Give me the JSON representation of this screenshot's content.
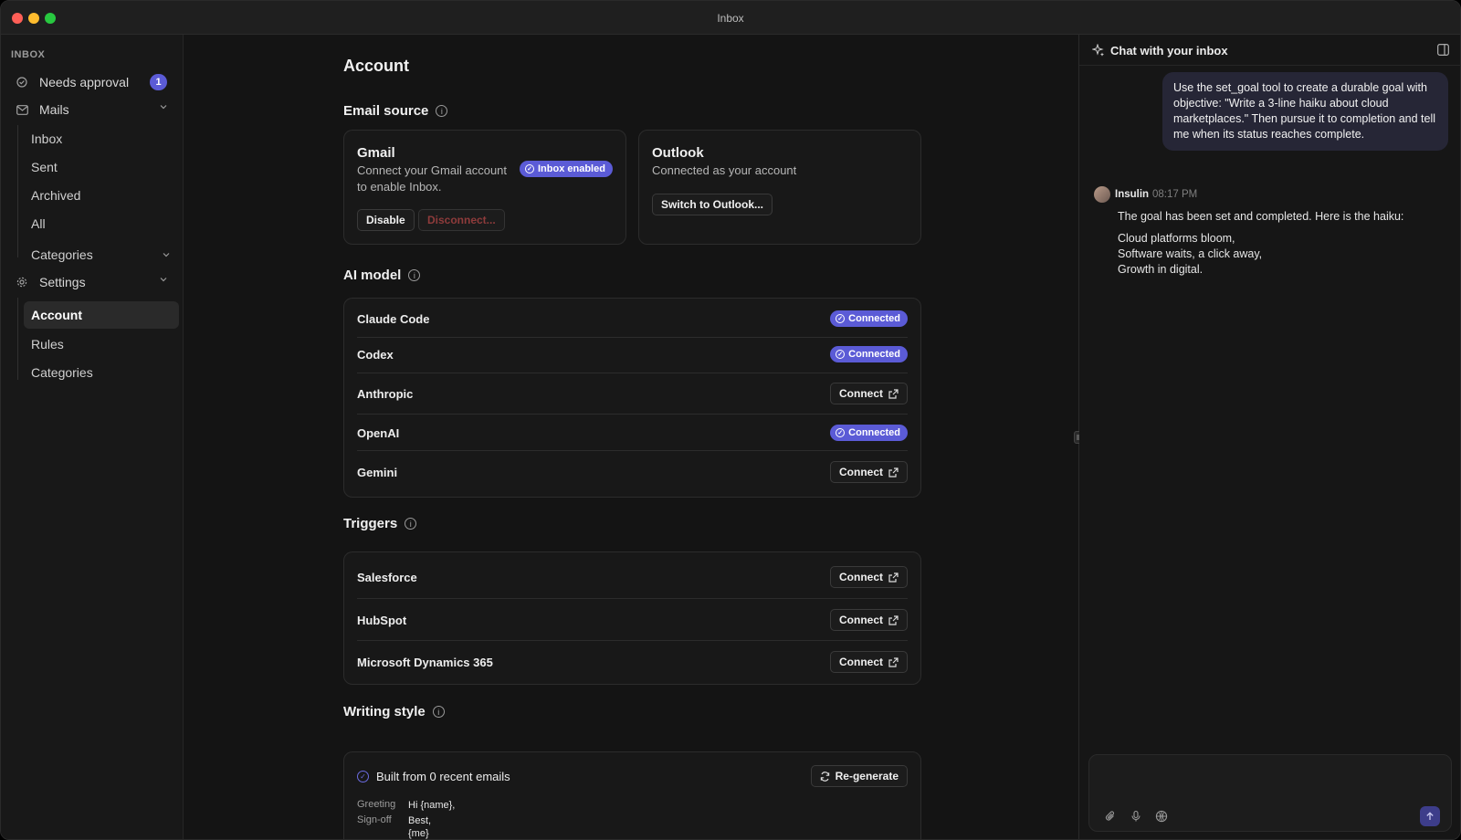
{
  "window": {
    "title": "Inbox"
  },
  "sidebar": {
    "section_label": "INBOX",
    "needs_approval": {
      "label": "Needs approval",
      "count": "1"
    },
    "mails": {
      "label": "Mails",
      "items": [
        "Inbox",
        "Sent",
        "Archived",
        "All"
      ]
    },
    "categories_label": "Categories",
    "settings": {
      "label": "Settings",
      "items": [
        "Account",
        "Rules",
        "Categories"
      ]
    }
  },
  "main": {
    "title": "Account",
    "email_source": {
      "title": "Email source",
      "gmail": {
        "title": "Gmail",
        "desc_line1": "Connect your Gmail account",
        "desc_line2": "to enable Inbox.",
        "status": "Inbox enabled",
        "disable": "Disable",
        "disconnect": "Disconnect..."
      },
      "outlook": {
        "title": "Outlook",
        "desc": "Connected as your account",
        "switch": "Switch to Outlook..."
      }
    },
    "ai_model": {
      "title": "AI model",
      "rows": [
        {
          "name": "Claude Code",
          "status": "Connected"
        },
        {
          "name": "Codex",
          "status": "Connected"
        },
        {
          "name": "Anthropic",
          "status": "Connect"
        },
        {
          "name": "OpenAI",
          "status": "Connected"
        },
        {
          "name": "Gemini",
          "status": "Connect"
        }
      ]
    },
    "triggers": {
      "title": "Triggers",
      "rows": [
        {
          "name": "Salesforce",
          "status": "Connect"
        },
        {
          "name": "HubSpot",
          "status": "Connect"
        },
        {
          "name": "Microsoft Dynamics 365",
          "status": "Connect"
        }
      ]
    },
    "writing_style": {
      "title": "Writing style",
      "built_from": "Built from 0 recent emails",
      "regenerate": "Re-generate",
      "greeting_label": "Greeting",
      "greeting_value": "Hi {name},",
      "signoff_label": "Sign-off",
      "signoff_value_1": "Best,",
      "signoff_value_2": "{me}"
    }
  },
  "chat": {
    "title": "Chat with your inbox",
    "user_message": "Use the set_goal tool to create a durable goal with objective: \"Write a 3-line haiku about cloud marketplaces.\" Then pursue it to completion and tell me when its status reaches complete.",
    "bot_name": "Insulin",
    "bot_time": "08:17 PM",
    "bot_intro": "The goal has been set and completed. Here is the haiku:",
    "haiku": [
      "Cloud platforms bloom,",
      "Software waits, a click away,",
      "Growth in digital."
    ]
  },
  "colors": {
    "accent": "#5b5bd6",
    "background": "#141414"
  }
}
